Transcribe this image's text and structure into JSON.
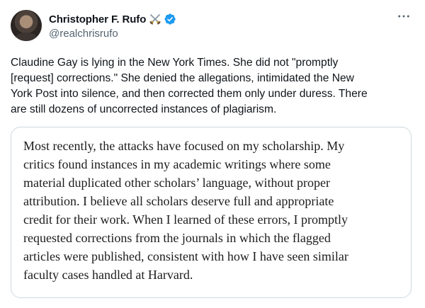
{
  "author": {
    "display_name": "Christopher F. Rufo",
    "handle": "@realchrisrufo",
    "name_emoji": "crossed-swords-icon",
    "verified_badge": "verified-badge-icon",
    "verified_color": "#1d9bf0"
  },
  "menu": {
    "more_icon": "more-horizontal-icon"
  },
  "tweet": {
    "text": "Claudine Gay is lying in the New York Times. She did not \"promptly\n[request] corrections.\" She denied the allegations, intimidated the New\nYork Post into silence, and then corrected them only under duress. There\nare still dozens of uncorrected instances of plagiarism."
  },
  "quote": {
    "text": "Most recently, the attacks have focused on my scholarship. My\ncritics found instances in my academic writings where some\nmaterial duplicated other scholars’ language, without proper\nattribution. I believe all scholars deserve full and appropriate\ncredit for their work. When I learned of these errors, I promptly\nrequested corrections from the journals in which the flagged\narticles were published, consistent with how I have seen similar\nfaculty cases handled at Harvard."
  }
}
